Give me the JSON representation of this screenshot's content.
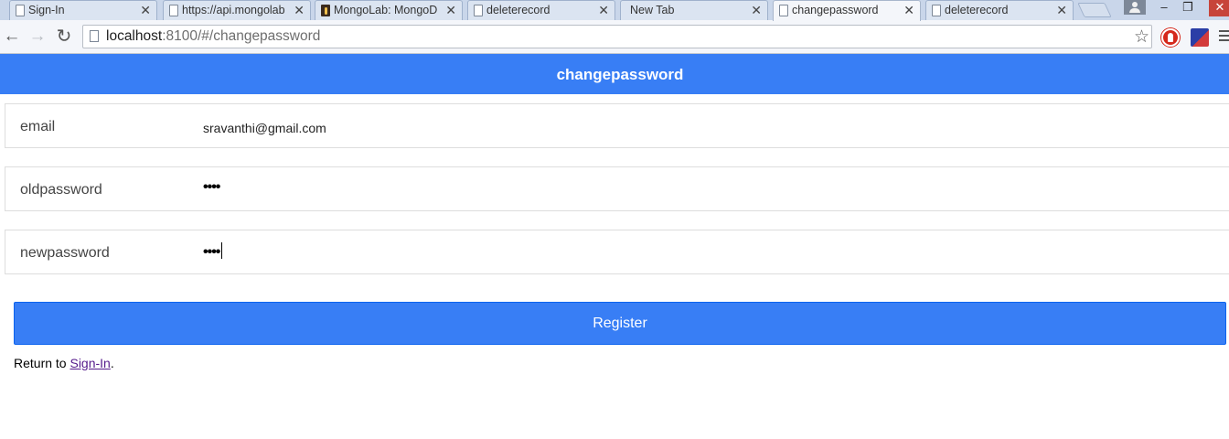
{
  "browser": {
    "tabs": [
      {
        "title": "Sign-In",
        "icon": "page-icon",
        "active": false
      },
      {
        "title": "https://api.mongolab",
        "icon": "page-icon",
        "active": false
      },
      {
        "title": "MongoLab: MongoD",
        "icon": "mongolab-icon",
        "active": false
      },
      {
        "title": "deleterecord",
        "icon": "page-icon",
        "active": false
      },
      {
        "title": "New Tab",
        "icon": "none",
        "active": false
      },
      {
        "title": "changepassword",
        "icon": "page-icon",
        "active": true
      },
      {
        "title": "deleterecord",
        "icon": "page-icon",
        "active": false
      }
    ],
    "tab_close_glyph": "✕",
    "url_host": "localhost",
    "url_rest": ":8100/#/changepassword",
    "nav": {
      "back": "←",
      "forward": "→",
      "reload": "↻",
      "star": "☆"
    }
  },
  "header": {
    "title": "changepassword"
  },
  "form": {
    "email": {
      "label": "email",
      "value": "sravanthi@gmail.com"
    },
    "oldpassword": {
      "label": "oldpassword",
      "value": "••••"
    },
    "newpassword": {
      "label": "newpassword",
      "value": "••••"
    }
  },
  "register_label": "Register",
  "footer": {
    "prefix": "Return to ",
    "link": "Sign-In",
    "suffix": "."
  },
  "colors": {
    "primary": "#387ef5",
    "tabstrip": "#c9d6ea",
    "link_visited": "#551a8b"
  }
}
